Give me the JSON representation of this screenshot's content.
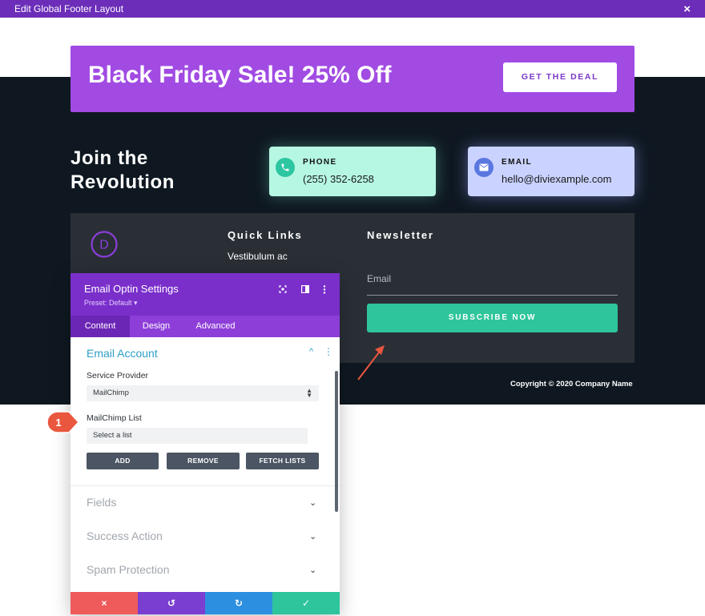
{
  "window": {
    "title": "Edit Global Footer Layout",
    "close_label": "×"
  },
  "banner": {
    "headline": "Black Friday Sale! 25% Off",
    "button_label": "GET THE DEAL"
  },
  "join": {
    "line1": "Join the",
    "line2": "Revolution"
  },
  "contact": {
    "phone": {
      "label": "PHONE",
      "value": "(255) 352-6258",
      "icon": "phone-icon"
    },
    "email": {
      "label": "EMAIL",
      "value": "hello@diviexample.com",
      "icon": "envelope-icon"
    }
  },
  "footer": {
    "logo_letter": "D",
    "quick_links_title": "Quick Links",
    "quick_link": "Vestibulum ac",
    "newsletter_title": "Newsletter",
    "email_placeholder": "Email",
    "subscribe_label": "SUBSCRIBE NOW",
    "copyright": "Copyright © 2020 Company Name"
  },
  "modal": {
    "title": "Email Optin Settings",
    "preset": "Preset: Default ▾",
    "tabs": [
      {
        "label": "Content",
        "active": true
      },
      {
        "label": "Design",
        "active": false
      },
      {
        "label": "Advanced",
        "active": false
      }
    ],
    "section_title": "Email Account",
    "service_provider_label": "Service Provider",
    "service_provider_value": "MailChimp",
    "list_label": "MailChimp List",
    "list_value": "Select a list",
    "buttons": {
      "add": "ADD",
      "remove": "REMOVE",
      "fetch": "FETCH LISTS"
    },
    "collapsed_sections": [
      "Fields",
      "Success Action",
      "Spam Protection"
    ],
    "footer_buttons": [
      "×",
      "↺",
      "↻",
      "✓"
    ]
  },
  "callout": {
    "number": "1"
  },
  "colors": {
    "brand_purple": "#7a2fcb",
    "banner_purple": "#a14be3",
    "teal": "#2ec59c",
    "dark_bg": "#0f1821",
    "panel_bg": "#2a2f36",
    "callout_red": "#e9573f"
  }
}
